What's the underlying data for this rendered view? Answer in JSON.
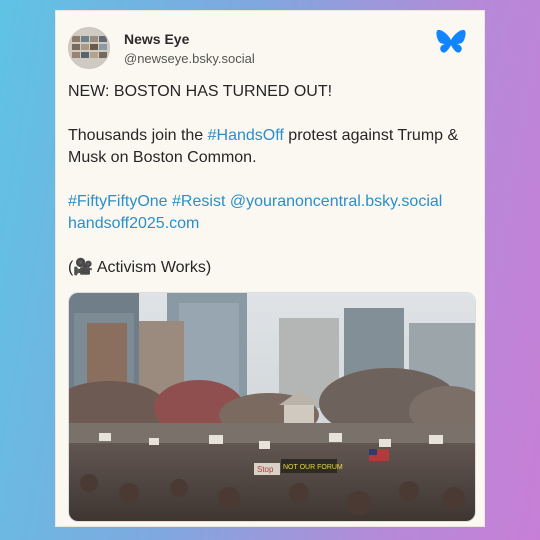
{
  "post": {
    "author_name": "News Eye",
    "author_handle": "@newseye.bsky.social",
    "line1": "NEW: BOSTON HAS TURNED OUT!",
    "line2_pre": "Thousands join the ",
    "line2_tag": "#HandsOff",
    "line2_post": " protest against Trump & Musk on Boston Common.",
    "tag_fifty": "#FiftyFiftyOne",
    "tag_resist": "#Resist",
    "mention": "@youranoncentral.bsky.social",
    "link_url": "handsoff2025.com",
    "footer": "(🎥 Activism Works)"
  },
  "media": {
    "sign_1": "Stop",
    "sign_2": "NOT OUR FORUM"
  },
  "icons": {
    "platform": "bluesky-butterfly-icon"
  },
  "colors": {
    "accent_link": "#2a8fca",
    "bluesky": "#1185fe"
  }
}
